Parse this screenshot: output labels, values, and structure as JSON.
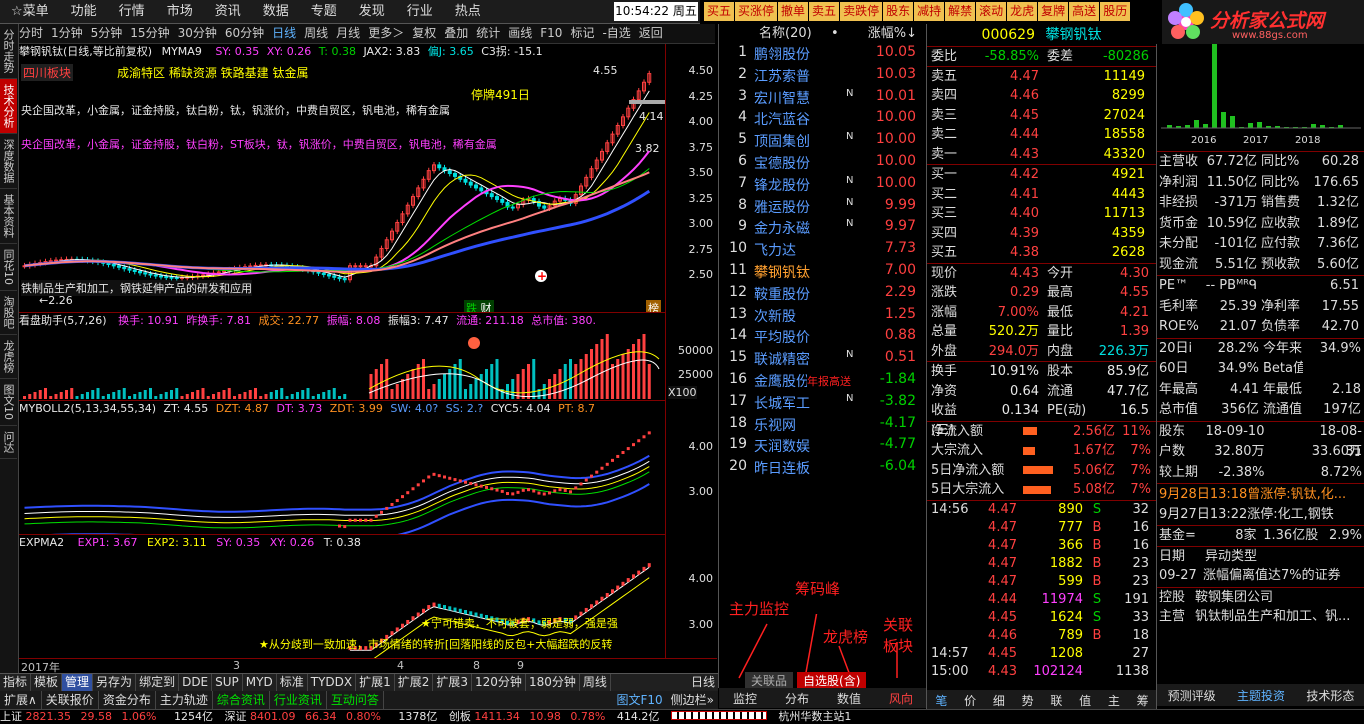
{
  "menu": {
    "items": [
      "☆菜单",
      "功能",
      "行情",
      "市场",
      "资讯",
      "数据",
      "专题",
      "发现",
      "行业",
      "热点"
    ],
    "clock": "10:54:22",
    "weekday": "周五"
  },
  "quick": [
    "买五",
    "买涨停",
    "撤单",
    "卖五",
    "卖跌停",
    "股东",
    "减持",
    "解禁",
    "滚动",
    "龙虎",
    "复牌",
    "高送",
    "股历"
  ],
  "logo": {
    "main": "分析家公式网",
    "sub": "www.88gs.com"
  },
  "vtabs": [
    "分时走势",
    "技术分析",
    "深度数据",
    "基本资料",
    "同花10",
    "淘股吧",
    "龙虎榜",
    "图文10",
    "问达"
  ],
  "periods": [
    "分时",
    "1分钟",
    "5分钟",
    "15分钟",
    "30分钟",
    "60分钟",
    "日线",
    "周线",
    "月线",
    "更多＞",
    "复权",
    "叠加",
    "统计",
    "画线",
    "F10",
    "标记",
    "-自选",
    "返回"
  ],
  "kline": {
    "title": "攀钢钒钛(日线,等比前复权)",
    "ma": "MYMA9",
    "sy": "SY: 0.35",
    "xy": "XY: 0.26",
    "t": "T: 0.38",
    "jax": "JAX2: 3.83",
    "pj": "偏J: 3.65",
    "c3": "C3拐: -15.1",
    "sector": "四川板块",
    "tags": "成渝特区 稀缺资源 铁路基建 钛金属",
    "concept1": "央企国改革，小金属，证金持股，钛白粉，钛，钒涨价，中费自贸区，钒电池，稀有金属",
    "concept2": "央企国改革，小金属，证金持股，钛白粉，ST板块，钛，钒涨价，中费自贸区，钒电池，稀有金属",
    "halt": "停牌491日",
    "hi": "4.55",
    "cur": "4.14",
    "mid": "3.82",
    "lo": "←2.26",
    "note": "铁制品生产和加工，钢铁延伸产品的研发和应用",
    "pills": [
      "跌",
      " 财",
      "榜"
    ],
    "axis": [
      "4.50",
      "4.25",
      "4.00",
      "3.75",
      "3.50",
      "3.25",
      "3.00",
      "2.75",
      "2.50"
    ]
  },
  "vol": {
    "name": "看盘助手(5,7,26)",
    "hs": "换手: 10.91",
    "zhs": "昨换手: 7.81",
    "cj": "成交: 22.77",
    "zf": "振幅: 8.08",
    "zf3": "振幅3: 7.47",
    "lt": "流通: 211.18",
    "zsz": "总市值: 380.",
    "axis": [
      "50000",
      "25000",
      "X100"
    ]
  },
  "boll": {
    "name": "MYBOLL2(5,13,34,55,34)",
    "zt": "ZT: 4.55",
    "dzt": "DZT: 4.87",
    "dt": "DT: 3.73",
    "zdt": "ZDT: 3.99",
    "sw": "SW: 4.0?",
    "ss": "SS: 2.?",
    "cyc": "CYC5: 4.04",
    "pt": "PT: 8.7",
    "axis": [
      "4.00",
      "3.00"
    ]
  },
  "expma": {
    "name": "EXPMA2",
    "e1": "EXP1: 3.67",
    "e2": "EXP2: 3.11",
    "sy": "SY: 0.35",
    "xy": "XY: 0.26",
    "t": "T: 0.38",
    "n1": "★宁可错卖，不可被套；弱是弱，强是强",
    "n2": "★从分歧到一致加速，市场情绪的转折[回落阳线的反包+大幅超跌的反转",
    "axis": [
      "4.00",
      "3.00"
    ]
  },
  "dates": [
    "2017年",
    "3",
    "4",
    "8",
    "9"
  ],
  "btm1": [
    "指标",
    "模板",
    "管理",
    "另存为",
    "绑定到",
    "DDE",
    "SUP",
    "MYD",
    "标准",
    "TYDDX",
    "扩展1",
    "扩展2",
    "扩展3",
    "120分钟",
    "180分钟",
    "周线"
  ],
  "btm1r": "日线",
  "btm2": [
    "扩展∧",
    "关联报价",
    "资金分布",
    "主力轨迹",
    "综合资讯",
    "行业资讯",
    "互动问答"
  ],
  "btm2r": "图文F10",
  "btm2r2": "侧边栏»",
  "list": {
    "hdr_name": "名称(20)",
    "hdr_dot": "•",
    "hdr_chg": "涨幅%↓",
    "rows": [
      {
        "n": "1",
        "name": "鹏翎股份",
        "f": "",
        "chg": "10.05"
      },
      {
        "n": "2",
        "name": "江苏索普",
        "f": "",
        "chg": "10.03"
      },
      {
        "n": "3",
        "name": "宏川智慧",
        "f": "N",
        "chg": "10.01"
      },
      {
        "n": "4",
        "name": "北汽蓝谷",
        "f": "",
        "chg": "10.00"
      },
      {
        "n": "5",
        "name": "顶固集创",
        "f": "N",
        "chg": "10.00"
      },
      {
        "n": "6",
        "name": "宝德股份",
        "f": "",
        "chg": "10.00"
      },
      {
        "n": "7",
        "name": "锋龙股份",
        "f": "N",
        "chg": "10.00"
      },
      {
        "n": "8",
        "name": "雅运股份",
        "f": "N",
        "chg": "9.99"
      },
      {
        "n": "9",
        "name": "金力永磁",
        "f": "N",
        "chg": "9.97"
      },
      {
        "n": "10",
        "name": "飞力达",
        "f": "",
        "chg": "7.73"
      },
      {
        "n": "11",
        "name": "攀钢钒钛",
        "f": "",
        "chg": "7.00"
      },
      {
        "n": "12",
        "name": "鞍重股份",
        "f": "",
        "chg": "2.29"
      },
      {
        "n": "13",
        "name": "次新股",
        "f": "",
        "chg": "1.25"
      },
      {
        "n": "14",
        "name": "平均股价",
        "f": "",
        "chg": "0.88"
      },
      {
        "n": "15",
        "name": "联诚精密",
        "f": "N",
        "chg": "0.51"
      },
      {
        "n": "16",
        "name": "金鹰股份",
        "f": "",
        "chg": "-1.84"
      },
      {
        "n": "17",
        "name": "长城军工",
        "f": "N",
        "chg": "-3.82"
      },
      {
        "n": "18",
        "name": "乐视网",
        "f": "",
        "chg": "-4.17"
      },
      {
        "n": "19",
        "name": "天润数娱",
        "f": "",
        "chg": "-4.77"
      },
      {
        "n": "20",
        "name": "昨日连板",
        "f": "",
        "chg": "-6.04"
      }
    ],
    "row15note": "年报高送",
    "tabs": [
      "关联品",
      "自选股(含)"
    ],
    "bottom": [
      "监控",
      "分布",
      "数值",
      "风向"
    ]
  },
  "annot": {
    "zlkk": "主力监控",
    "cmf": "筹码峰",
    "lhb": "龙虎榜",
    "glbk": "关联板块"
  },
  "quote": {
    "code": "000629",
    "name": "攀钢钒钛",
    "wb": "委比",
    "wbv": "-58.85%",
    "wc": "委差",
    "wcv": "-80286",
    "sell": [
      {
        "l": "卖五",
        "p": "4.47",
        "v": "11149"
      },
      {
        "l": "卖四",
        "p": "4.46",
        "v": "8299"
      },
      {
        "l": "卖三",
        "p": "4.45",
        "v": "27024"
      },
      {
        "l": "卖二",
        "p": "4.44",
        "v": "18558"
      },
      {
        "l": "卖一",
        "p": "4.43",
        "v": "43320"
      }
    ],
    "buy": [
      {
        "l": "买一",
        "p": "4.42",
        "v": "4921"
      },
      {
        "l": "买二",
        "p": "4.41",
        "v": "4443"
      },
      {
        "l": "买三",
        "p": "4.40",
        "v": "11713"
      },
      {
        "l": "买四",
        "p": "4.39",
        "v": "4359"
      },
      {
        "l": "买五",
        "p": "4.38",
        "v": "2628"
      }
    ],
    "stats": [
      {
        "a": "现价",
        "b": "4.43",
        "c": "今开",
        "d": "4.30"
      },
      {
        "a": "涨跌",
        "b": "0.29",
        "c": "最高",
        "d": "4.55"
      },
      {
        "a": "涨幅",
        "b": "7.00%",
        "c": "最低",
        "d": "4.21"
      },
      {
        "a": "总量",
        "b": "520.2万",
        "c": "量比",
        "d": "1.39"
      },
      {
        "a": "外盘",
        "b": "294.0万",
        "c": "内盘",
        "d": "226.3万"
      }
    ],
    "stats2": [
      {
        "a": "换手",
        "b": "10.91%",
        "c": "股本",
        "d": "85.9亿"
      },
      {
        "a": "净资",
        "b": "0.64",
        "c": "流通",
        "d": "47.7亿"
      },
      {
        "a": "收益(三)",
        "b": "0.134",
        "c": "PE(动)",
        "d": "16.5"
      }
    ],
    "flow": [
      {
        "a": "净流入额",
        "b": "2.56亿",
        "c": "11%"
      },
      {
        "a": "大宗流入",
        "b": "1.67亿",
        "c": "7%"
      },
      {
        "a": "5日净流入额",
        "b": "5.06亿",
        "c": "7%"
      },
      {
        "a": "5日大宗流入",
        "b": "5.08亿",
        "c": "7%"
      }
    ],
    "ticks": [
      {
        "t": "14:56",
        "p": "4.47",
        "v": "890",
        "s": "S",
        "n": "32"
      },
      {
        "t": "",
        "p": "4.47",
        "v": "777",
        "s": "B",
        "n": "16"
      },
      {
        "t": "",
        "p": "4.47",
        "v": "366",
        "s": "B",
        "n": "16"
      },
      {
        "t": "",
        "p": "4.47",
        "v": "1882",
        "s": "B",
        "n": "23"
      },
      {
        "t": "",
        "p": "4.47",
        "v": "599",
        "s": "B",
        "n": "23"
      },
      {
        "t": "",
        "p": "4.44",
        "v": "11974",
        "s": "S",
        "n": "191"
      },
      {
        "t": "",
        "p": "4.45",
        "v": "1624",
        "s": "S",
        "n": "33"
      },
      {
        "t": "",
        "p": "4.46",
        "v": "789",
        "s": "B",
        "n": "18"
      },
      {
        "t": "14:57",
        "p": "4.45",
        "v": "1208",
        "s": "",
        "n": "27"
      },
      {
        "t": "15:00",
        "p": "4.43",
        "v": "102124",
        "s": "",
        "n": "1138"
      }
    ],
    "tabs": [
      "笔",
      "价",
      "细",
      "势",
      "联",
      "值",
      "主",
      "筹"
    ]
  },
  "f10": {
    "bars_years": [
      "2016",
      "2017",
      "2018"
    ],
    "rows": [
      {
        "a": "主营收",
        "b": "67.72亿",
        "c": "同比%",
        "d": "60.28"
      },
      {
        "a": "净利润",
        "b": "11.50亿",
        "c": "同比%",
        "d": "176.65"
      },
      {
        "a": "非经损",
        "b": "-371万",
        "c": "销售费",
        "d": "1.32亿"
      },
      {
        "a": "货币金",
        "b": "10.59亿",
        "c": "应收款",
        "d": "1.89亿"
      },
      {
        "a": "未分配",
        "b": "-101亿",
        "c": "应付款",
        "d": "7.36亿"
      },
      {
        "a": "现金流",
        "b": "5.51亿",
        "c": "预收款",
        "d": "5.60亿"
      }
    ],
    "rows2": [
      {
        "a": "PE™",
        "b": "-- PBᴹᴿᑫ",
        "c": "",
        "d": "6.51"
      },
      {
        "a": "毛利率",
        "b": "25.39",
        "c": "净利率",
        "d": "17.55"
      },
      {
        "a": "ROE%",
        "b": "21.07",
        "c": "负债率",
        "d": "42.70"
      }
    ],
    "rows3": [
      {
        "a": "20日i",
        "b": "28.2%",
        "c": "今年来",
        "d": "34.9%"
      },
      {
        "a": "60日",
        "b": "34.9%",
        "c": "Beta值",
        "d": ""
      },
      {
        "a": "年最高",
        "b": "4.41",
        "c": "年最低",
        "d": "2.18"
      },
      {
        "a": "总市值",
        "b": "356亿",
        "c": "流通值",
        "d": "197亿"
      }
    ],
    "rows4": [
      {
        "a": "股东",
        "b": "18-09-10",
        "c": "",
        "d": "18-08-31"
      },
      {
        "a": "户数",
        "b": "32.80万",
        "c": "",
        "d": "33.60万"
      },
      {
        "a": "较上期",
        "b": "-2.38%",
        "c": "",
        "d": "8.72%"
      }
    ],
    "news1": "9月28日13:18曾涨停:钒钛,化...",
    "news2": "9月27日13:22涨停:化工,钢铁",
    "fund": {
      "a": "基金=",
      "b": "8家",
      "c": "1.36亿股",
      "d": "2.9%"
    },
    "cat": {
      "a": "日期",
      "b": "异动类型"
    },
    "evt": {
      "a": "09-27",
      "b": "涨幅偏离值达7%的证券"
    },
    "holder": {
      "a": "控股",
      "b": "鞍钢集团公司"
    },
    "biz": {
      "a": "主营",
      "b": "钒钛制品生产和加工、钒..."
    },
    "tabs": [
      "预测评级",
      "主题投资",
      "技术形态"
    ]
  },
  "status": {
    "sh": "上证",
    "sh_v": "2821.35",
    "sh_c": "29.58",
    "sh_p": "1.06%",
    "sh_a": "1254亿",
    "sz": "深证",
    "sz_v": "8401.09",
    "sz_c": "66.34",
    "sz_p": "0.80%",
    "sz_a": "1378亿",
    "cy": "创板",
    "cy_v": "1411.34",
    "cy_c": "10.98",
    "cy_p": "0.78%",
    "cy_a": "414.2亿",
    "site": "杭州华数主站1"
  },
  "colors": {
    "up": "#ff4040",
    "down": "#00d000",
    "blue": "#5a9cff",
    "frame": "#800000"
  }
}
